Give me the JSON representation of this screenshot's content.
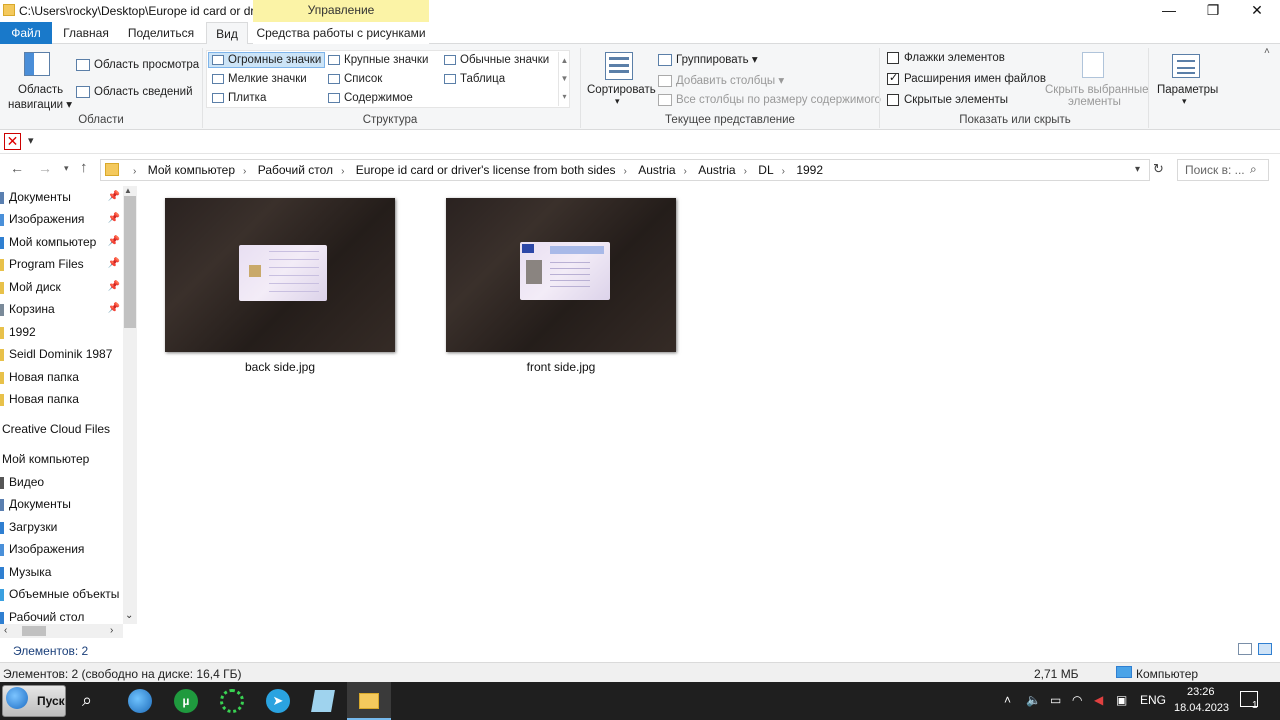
{
  "window": {
    "title": "C:\\Users\\rocky\\Desktop\\Europe  id card or dr...",
    "manage_label": "Управление",
    "minimize": "—",
    "maximize": "❐",
    "close": "✕"
  },
  "tabs": {
    "file": "Файл",
    "home": "Главная",
    "share": "Поделиться",
    "view": "Вид",
    "picture_tools": "Средства работы с рисунками"
  },
  "ribbon": {
    "areas": {
      "nav_pane_line1": "Область",
      "nav_pane_line2": "навигации",
      "preview_pane": "Область просмотра",
      "details_pane": "Область сведений",
      "label": "Области"
    },
    "layout": {
      "extra_large": "Огромные значки",
      "large": "Крупные значки",
      "medium": "Обычные значки",
      "small": "Мелкие значки",
      "list": "Список",
      "details": "Таблица",
      "tiles": "Плитка",
      "content": "Содержимое",
      "label": "Структура"
    },
    "current_view": {
      "sort": "Сортировать",
      "group": "Группировать",
      "add_columns": "Добавить столбцы",
      "fit_columns": "Все столбцы по размеру содержимого",
      "label": "Текущее представление"
    },
    "show_hide": {
      "item_checkboxes": "Флажки элементов",
      "extensions": "Расширения имен файлов",
      "hidden_items": "Скрытые элементы",
      "hide_selected_line1": "Скрыть выбранные",
      "hide_selected_line2": "элементы",
      "label": "Показать или скрыть"
    },
    "options": "Параметры"
  },
  "address": {
    "crumbs": [
      "Мой компьютер",
      "Рабочий стол",
      "Europe  id card or driver's license from both sides",
      "Austria",
      "Austria",
      "DL",
      "1992"
    ],
    "search_placeholder": "Поиск в: ..."
  },
  "sidebar": {
    "items": [
      {
        "label": "Документы",
        "color": "#5a7fb0",
        "pinned": true
      },
      {
        "label": "Изображения",
        "color": "#4a90d9",
        "pinned": true
      },
      {
        "label": "Мой компьютер",
        "color": "#2f7fd1",
        "pinned": true
      },
      {
        "label": "Program Files",
        "color": "#e8c14a",
        "pinned": true
      },
      {
        "label": "Мой диск",
        "color": "#e8c14a",
        "pinned": true
      },
      {
        "label": "Корзина",
        "color": "#7a8a99",
        "pinned": true
      },
      {
        "label": "1992",
        "color": "#e8c14a",
        "pinned": false
      },
      {
        "label": "Seidl Dominik 1987",
        "color": "#e8c14a",
        "pinned": false
      },
      {
        "label": "Новая папка",
        "color": "#e8c14a",
        "pinned": false
      },
      {
        "label": "Новая папка",
        "color": "#e8c14a",
        "pinned": false
      }
    ],
    "creative_cloud": "Creative Cloud Files",
    "my_computer": "Мой компьютер",
    "computer_items": [
      {
        "label": "Видео",
        "color": "#555555"
      },
      {
        "label": "Документы",
        "color": "#5a7fb0"
      },
      {
        "label": "Загрузки",
        "color": "#2f7fd1"
      },
      {
        "label": "Изображения",
        "color": "#4a90d9"
      },
      {
        "label": "Музыка",
        "color": "#2f7fd1"
      },
      {
        "label": "Объемные объекты",
        "color": "#3aa0e0"
      },
      {
        "label": "Рабочий стол",
        "color": "#2f7fd1"
      }
    ]
  },
  "files": [
    {
      "name": "back side.jpg"
    },
    {
      "name": "front side.jpg"
    }
  ],
  "status": {
    "count": "Элементов: 2",
    "summary": "Элементов: 2 (свободно на диске: 16,4 ГБ)",
    "size": "2,71 МБ",
    "location": "Компьютер"
  },
  "taskbar": {
    "start": "Пуск",
    "lang": "ENG",
    "time": "23:26",
    "date": "18.04.2023",
    "notification_count": "1"
  }
}
